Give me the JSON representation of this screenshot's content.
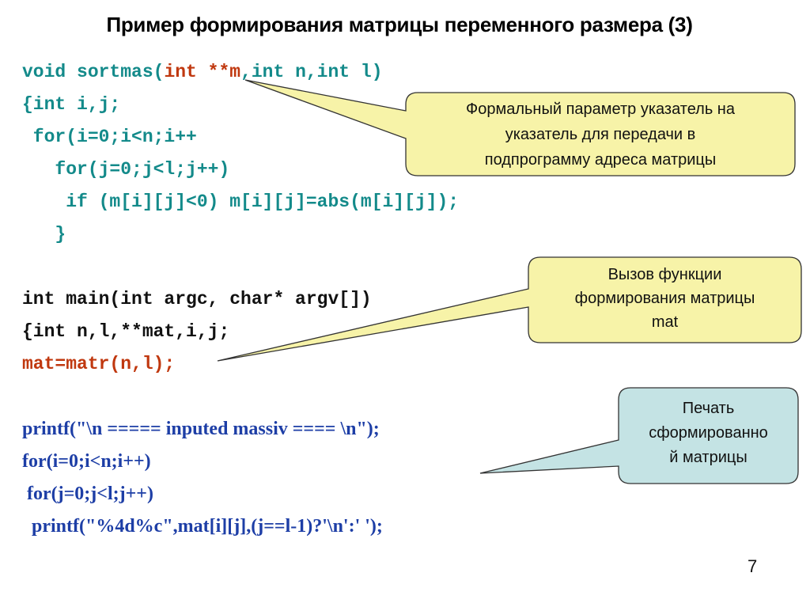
{
  "title": "Пример формирования матрицы переменного размера (3)",
  "code": {
    "sortmas_signature": {
      "pre": "void sortmas(",
      "highlight": "int **m",
      "post": ",int n,int l)"
    },
    "sortmas_body": [
      "{int i,j;",
      " for(i=0;i<n;i++",
      "   for(j=0;j<l;j++)",
      "    if (m[i][j]<0) m[i][j]=abs(m[i][j]);",
      "   }"
    ],
    "main_lines": [
      "int main(int argc, char* argv[])",
      "{int n,l,**mat,i,j;"
    ],
    "matr_call": "mat=matr(n,l);",
    "print_lines": [
      "printf(\"\\n ===== inputed massiv ==== \\n\");",
      "for(i=0;i<n;i++)",
      " for(j=0;j<l;j++)",
      "  printf(\"%4d%c\",mat[i][j],(j==l-1)?'\\n':' ');"
    ]
  },
  "callouts": {
    "formal_param": {
      "lines": [
        "Формальный параметр указатель на",
        "указатель для передачи в",
        "подпрограмму адреса матрицы"
      ],
      "fill": "#f7f3a8"
    },
    "func_call": {
      "lines": [
        "Вызов функции",
        "формирования матрицы",
        "mat"
      ],
      "fill": "#f7f3a8"
    },
    "print_matrix": {
      "lines": [
        "Печать",
        "сформированно",
        "й матрицы"
      ],
      "fill": "#c4e3e4"
    }
  },
  "page_number": "7"
}
